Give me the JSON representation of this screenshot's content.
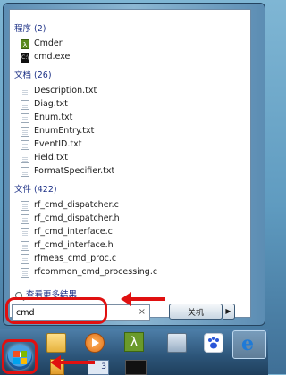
{
  "start_menu": {
    "groups": [
      {
        "header": "程序 (2)",
        "items": [
          {
            "label": "Cmder",
            "icon": "lambda-icon"
          },
          {
            "label": "cmd.exe",
            "icon": "console-icon"
          }
        ]
      },
      {
        "header": "文档 (26)",
        "items": [
          {
            "label": "Description.txt",
            "icon": "text-file-icon"
          },
          {
            "label": "Diag.txt",
            "icon": "text-file-icon"
          },
          {
            "label": "Enum.txt",
            "icon": "text-file-icon"
          },
          {
            "label": "EnumEntry.txt",
            "icon": "text-file-icon"
          },
          {
            "label": "EventID.txt",
            "icon": "text-file-icon"
          },
          {
            "label": "Field.txt",
            "icon": "text-file-icon"
          },
          {
            "label": "FormatSpecifier.txt",
            "icon": "text-file-icon"
          }
        ]
      },
      {
        "header": "文件 (422)",
        "items": [
          {
            "label": "rf_cmd_dispatcher.c",
            "icon": "text-file-icon"
          },
          {
            "label": "rf_cmd_dispatcher.h",
            "icon": "text-file-icon"
          },
          {
            "label": "rf_cmd_interface.c",
            "icon": "text-file-icon"
          },
          {
            "label": "rf_cmd_interface.h",
            "icon": "text-file-icon"
          },
          {
            "label": "rfmeas_cmd_proc.c",
            "icon": "text-file-icon"
          },
          {
            "label": "rfcommon_cmd_processing.c",
            "icon": "text-file-icon"
          }
        ]
      }
    ],
    "see_more": "查看更多结果",
    "search": {
      "value": "cmd",
      "clear": "×"
    },
    "shutdown": {
      "label": "关机",
      "arrow": "▶"
    }
  },
  "taskbar": {
    "items": [
      {
        "name": "start-button",
        "icon": "windows-orb-icon"
      },
      {
        "name": "explorer",
        "icon": "folder-icon"
      },
      {
        "name": "media-player",
        "icon": "media-play-icon"
      },
      {
        "name": "cmder",
        "icon": "lambda-icon",
        "text": "λ"
      },
      {
        "name": "network",
        "icon": "network-icon"
      },
      {
        "name": "baidu",
        "icon": "paw-icon"
      },
      {
        "name": "internet-explorer",
        "icon": "ie-icon",
        "text": "e"
      },
      {
        "name": "console",
        "icon": "console-icon"
      },
      {
        "name": "monitor",
        "icon": "chart-icon",
        "text": "3"
      }
    ]
  },
  "colors": {
    "annotation": "#e01010",
    "header": "#1e3287"
  }
}
